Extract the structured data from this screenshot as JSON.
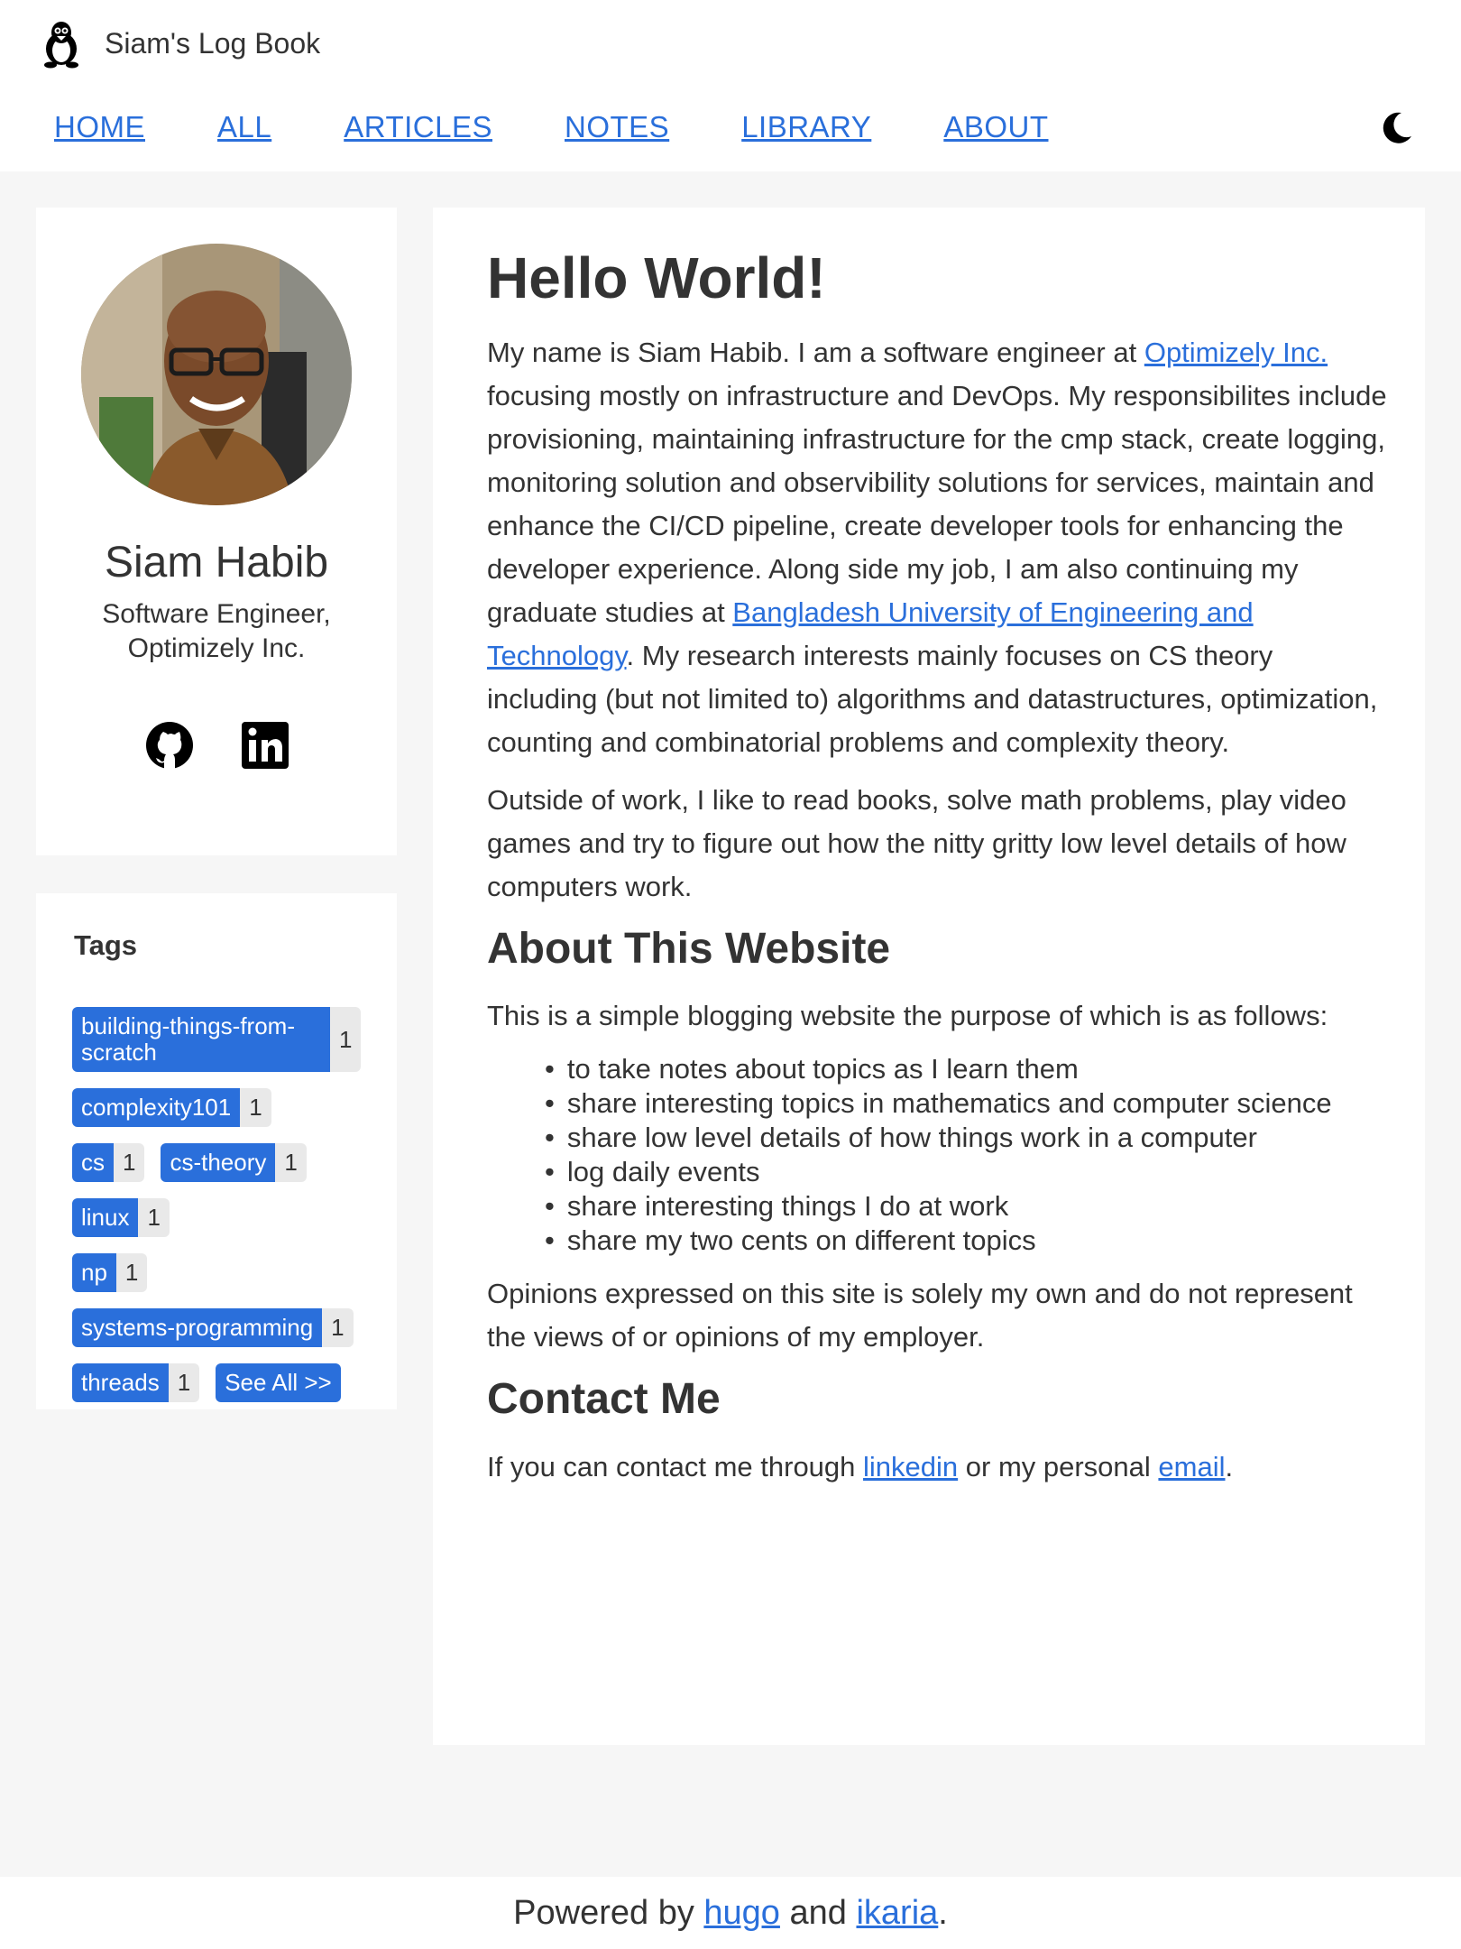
{
  "header": {
    "title": "Siam's Log Book",
    "nav": [
      "HOME",
      "ALL",
      "ARTICLES",
      "NOTES",
      "LIBRARY",
      "ABOUT"
    ]
  },
  "profile": {
    "name": "Siam Habib",
    "role": "Software Engineer, Optimizely Inc."
  },
  "tags": {
    "title": "Tags",
    "items": [
      {
        "name": "building-things-from-scratch",
        "count": "1"
      },
      {
        "name": "complexity101",
        "count": "1"
      },
      {
        "name": "cs",
        "count": "1"
      },
      {
        "name": "cs-theory",
        "count": "1"
      },
      {
        "name": "linux",
        "count": "1"
      },
      {
        "name": "np",
        "count": "1"
      },
      {
        "name": "systems-programming",
        "count": "1"
      },
      {
        "name": "threads",
        "count": "1"
      }
    ],
    "see_all": "See All >>"
  },
  "article": {
    "title": "Hello World!",
    "p1_a": "My name is Siam Habib. I am a software engineer at ",
    "p1_link1": "Optimizely Inc.",
    "p1_b": " focusing mostly on infrastructure and DevOps. My responsibilites include provisioning, maintaining infrastructure for the cmp stack, create logging, monitoring solution and observibility solutions for services, maintain and enhance the CI/CD pipeline, create developer tools for enhancing the developer experience. Along side my job, I am also continuing my graduate studies at ",
    "p1_link2": "Bangladesh University of Engineering and Technology",
    "p1_c": ". My research interests mainly focuses on CS theory including (but not limited to) algorithms and datastructures, optimization, counting and combinatorial problems and complexity theory.",
    "p2": "Outside of work, I like to read books, solve math problems, play video games and try to figure out how the nitty gritty low level details of how computers work.",
    "h_about": "About This Website",
    "p3": "This is a simple blogging website the purpose of which is as follows:",
    "purposes": [
      "to take notes about topics as I learn them",
      "share interesting topics in mathematics and computer science",
      "share low level details of how things work in a computer",
      "log daily events",
      "share interesting things I do at work",
      "share my two cents on different topics"
    ],
    "p4": "Opinions expressed on this site is solely my own and do not represent the views of or opinions of my employer.",
    "h_contact": "Contact Me",
    "contact_a": "If you can contact me through ",
    "contact_link1": "linkedin",
    "contact_b": " or my personal ",
    "contact_link2": "email",
    "contact_c": "."
  },
  "footer": {
    "a": "Powered by ",
    "link1": "hugo",
    "b": " and ",
    "link2": "ikaria",
    "c": "."
  },
  "colors": {
    "accent": "#2a6fdb",
    "background": "#f6f6f6",
    "card": "#ffffff",
    "text": "#333333"
  },
  "icons": [
    "penguin-logo-icon",
    "moon-icon",
    "github-icon",
    "linkedin-icon"
  ]
}
